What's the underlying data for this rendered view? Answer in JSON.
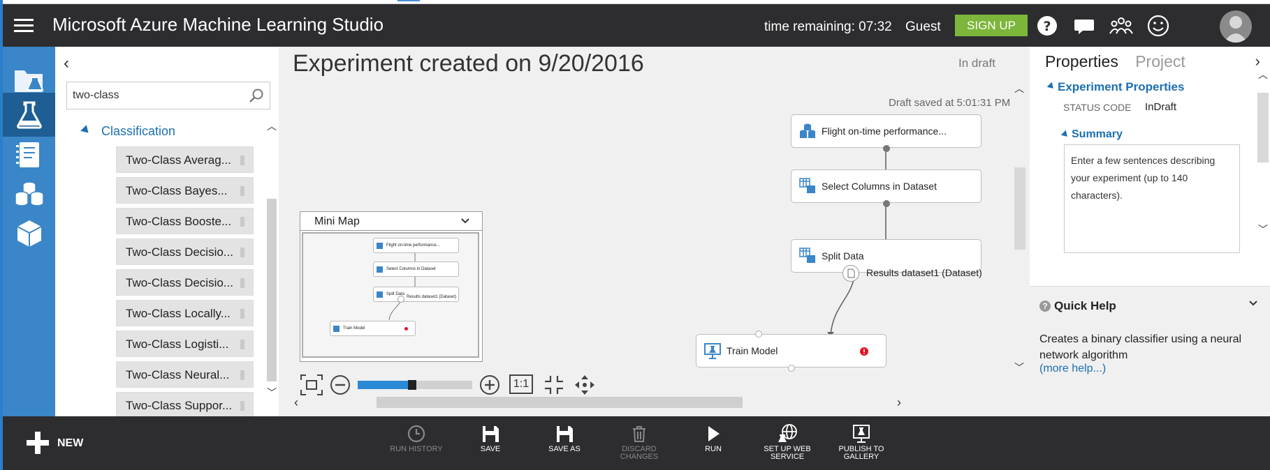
{
  "header": {
    "app_title": "Microsoft Azure Machine Learning Studio",
    "time_label": "time remaining:",
    "time_value": "07:32",
    "user": "Guest",
    "signup_label": "SIGN UP"
  },
  "palette": {
    "search_value": "two-class",
    "category": "Classification",
    "modules": [
      "Two-Class Averag...",
      "Two-Class Bayes...",
      "Two-Class Booste...",
      "Two-Class Decisio...",
      "Two-Class Decisio...",
      "Two-Class Locally...",
      "Two-Class Logisti...",
      "Two-Class Neural...",
      "Two-Class Suppor..."
    ]
  },
  "canvas": {
    "title": "Experiment created on 9/20/2016",
    "status": "In draft",
    "draft_saved": "Draft saved at 5:01:31 PM",
    "nodes": {
      "flight": "Flight on-time performance...",
      "select": "Select Columns in Dataset",
      "split": "Split Data",
      "train": "Train Model"
    },
    "result_port_label": "Results dataset1 (Dataset)",
    "minimap": {
      "title": "Mini Map",
      "nodes": {
        "flight": "Flight on-time performance...",
        "select": "Select Columns in Dataset",
        "split": "Split Data",
        "result": "Results dataset1 (Dataset)",
        "train": "Train Model"
      }
    },
    "zoom_actual_label": "1:1",
    "zoom_level": 0.5
  },
  "properties": {
    "tabs": [
      "Properties",
      "Project"
    ],
    "section_title": "Experiment Properties",
    "status_code_label": "STATUS CODE",
    "status_code_value": "InDraft",
    "summary_title": "Summary",
    "summary_placeholder": "Enter a few sentences describing your experiment (up to 140 characters).",
    "quick_help": {
      "title": "Quick Help",
      "text": "Creates a binary classifier using a neural network algorithm",
      "link": "(more help...)"
    }
  },
  "bottom": {
    "new_label": "NEW",
    "actions": [
      {
        "label": "RUN HISTORY",
        "icon": "clock-icon",
        "enabled": false
      },
      {
        "label": "SAVE",
        "icon": "save-icon",
        "enabled": true
      },
      {
        "label": "SAVE AS",
        "icon": "save-as-icon",
        "enabled": true
      },
      {
        "label": "DISCARD CHANGES",
        "icon": "trash-icon",
        "enabled": false
      },
      {
        "label": "RUN",
        "icon": "play-icon",
        "enabled": true
      },
      {
        "label": "SET UP WEB SERVICE",
        "icon": "web-service-icon",
        "enabled": true
      },
      {
        "label": "PUBLISH TO GALLERY",
        "icon": "gallery-icon",
        "enabled": true
      }
    ]
  },
  "colors": {
    "header_bg": "#2d2d30",
    "rail_bg": "#3a86c8",
    "accent_blue": "#1c6fb2",
    "signup_green": "#7cb63a",
    "error_red": "#e81123"
  }
}
